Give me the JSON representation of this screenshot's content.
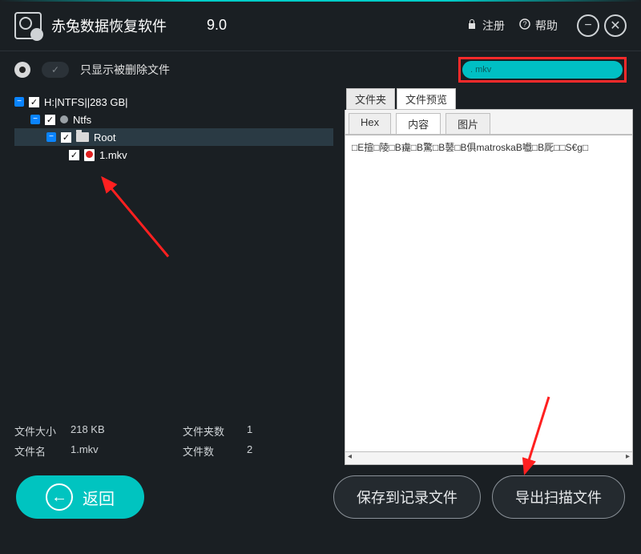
{
  "header": {
    "app_title": "赤兔数据恢复软件",
    "version": "9.0",
    "register": "注册",
    "help": "帮助"
  },
  "filter": {
    "label": "只显示被删除文件",
    "search_value": ". mkv"
  },
  "tree": {
    "n0": "H:|NTFS||283 GB|",
    "n1": "Ntfs",
    "n2": "Root",
    "n3": "1.mkv"
  },
  "info": {
    "filesize_label": "文件大小",
    "filesize_value": "218 KB",
    "foldercount_label": "文件夹数",
    "foldercount_value": "1",
    "filename_label": "文件名",
    "filename_value": "1.mkv",
    "filecount_label": "文件数",
    "filecount_value": "2"
  },
  "preview": {
    "tab_folder": "文件夹",
    "tab_preview": "文件预览",
    "sub_hex": "Hex",
    "sub_content": "内容",
    "sub_image": "图片",
    "content_text": "□E揎□陵□B䶶□B驚□B䵽□B俱matroskaB嚱□B厑□□S€g□"
  },
  "buttons": {
    "back": "返回",
    "save_log": "保存到记录文件",
    "export": "导出扫描文件"
  }
}
